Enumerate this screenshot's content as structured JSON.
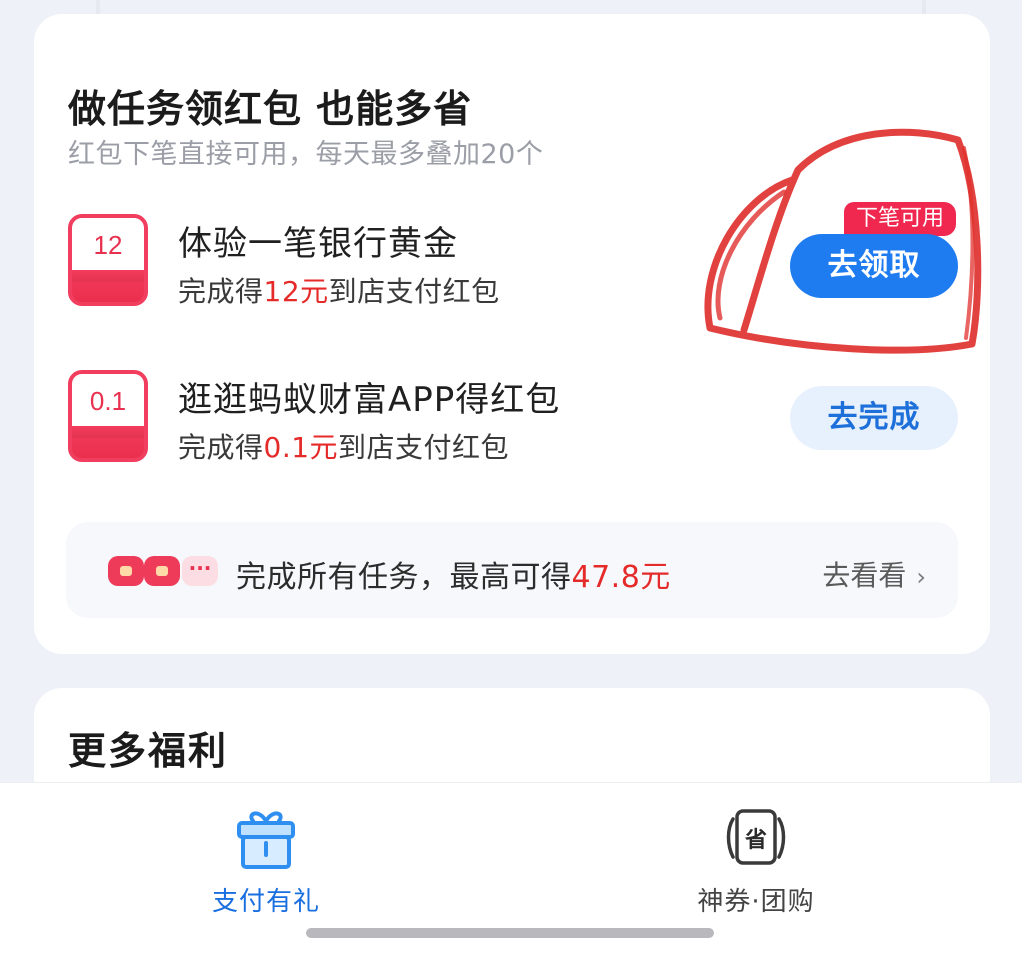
{
  "tasks_card": {
    "title": "做任务领红包 也能多省",
    "subtitle": "红包下笔直接可用，每天最多叠加20个",
    "tasks": [
      {
        "badge_value": "12",
        "name": "体验一笔银行黄金",
        "desc_prefix": "完成得",
        "desc_amount": "12元",
        "desc_suffix": "到店支付红包",
        "tag": "下笔可用",
        "button": "去领取"
      },
      {
        "badge_value": "0.1",
        "name": "逛逛蚂蚁财富APP得红包",
        "desc_prefix": "完成得",
        "desc_amount": "0.1元",
        "desc_suffix": "到店支付红包",
        "button": "去完成"
      }
    ],
    "summary": {
      "more_icon": "···",
      "text_prefix": "完成所有任务，最高可得",
      "amount": "47.8元",
      "link": "去看看",
      "chevron": "›"
    }
  },
  "more_card": {
    "title": "更多福利"
  },
  "tabbar": {
    "tabs": [
      {
        "label": "支付有礼",
        "icon": "gift-icon",
        "active": true
      },
      {
        "label": "神券·团购",
        "icon": "coupon-save-icon",
        "icon_text": "省",
        "active": false
      }
    ]
  },
  "colors": {
    "accent_blue": "#1e7cf0",
    "amount_red": "#e52a2a",
    "badge_red": "#f23e5e",
    "annotation_red": "#e0322f"
  }
}
